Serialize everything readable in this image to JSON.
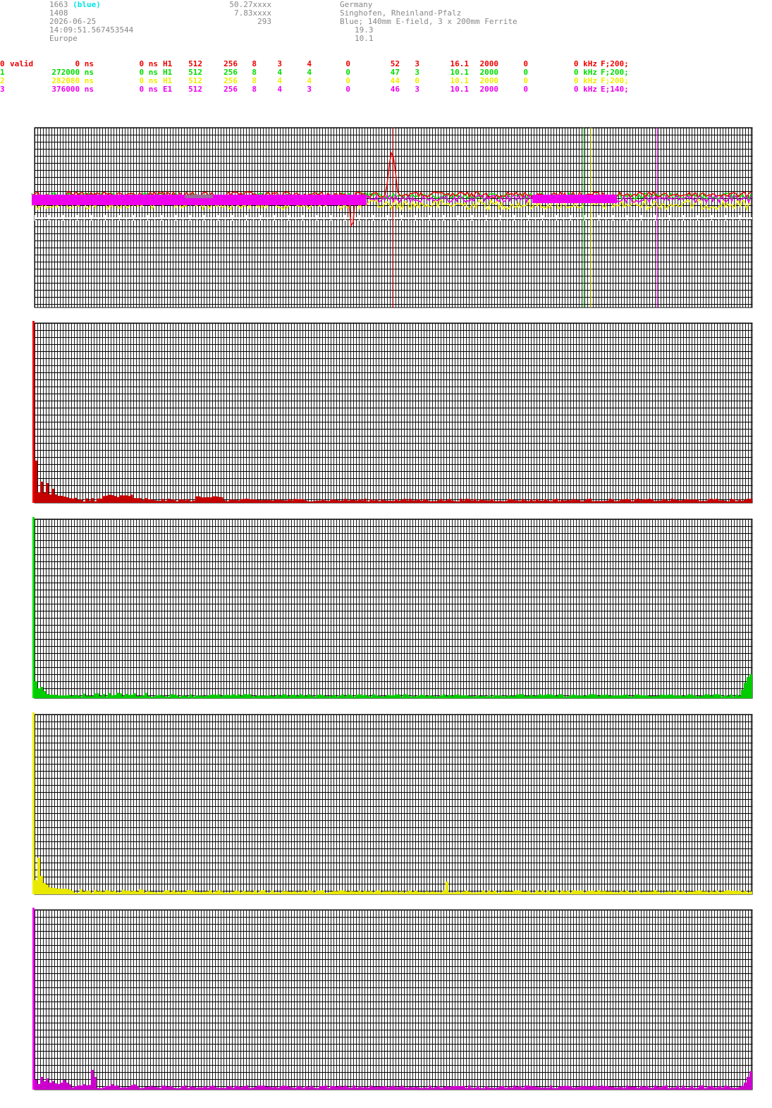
{
  "station": {
    "id": "1663",
    "id_tag": "(blue)",
    "id_tag_color": "#00e5e5",
    "number": "1408",
    "date": "2026-06-25",
    "time": "14:09:51.567453544",
    "region": "Europe",
    "lat": "50.27xxxx",
    "lon": "7.83xxxx",
    "alt": "293",
    "country": "Germany",
    "place": "Singhofen, Rheinland-Pfalz",
    "antenna": "Blue; 140mm E-field, 3 x 200mm Ferrite",
    "val1": "19.3",
    "val2": "10.1"
  },
  "channels": [
    {
      "idx": "0",
      "label": "valid",
      "offset": "0 ns",
      "delay": "0 ns",
      "type": "H1",
      "c1": "512",
      "c2": "256",
      "c3": "8",
      "c4": "3",
      "c5": "4",
      "c6": "0",
      "c7": "52",
      "c8": "3",
      "c9": "16.1",
      "c10": "2000",
      "c11": "0",
      "khz": "0 kHz",
      "cfg": "F;200;",
      "color": "#ee0000",
      "bar": "#c40000"
    },
    {
      "idx": "1",
      "label": "",
      "offset": "272000 ns",
      "delay": "0 ns",
      "type": "H1",
      "c1": "512",
      "c2": "256",
      "c3": "8",
      "c4": "4",
      "c5": "4",
      "c6": "0",
      "c7": "47",
      "c8": "3",
      "c9": "10.1",
      "c10": "2000",
      "c11": "0",
      "khz": "0 kHz",
      "cfg": "F;200;",
      "color": "#00dd00",
      "bar": "#00cc00"
    },
    {
      "idx": "2",
      "label": "",
      "offset": "282080 ns",
      "delay": "0 ns",
      "type": "H1",
      "c1": "512",
      "c2": "256",
      "c3": "8",
      "c4": "4",
      "c5": "4",
      "c6": "0",
      "c7": "44",
      "c8": "0",
      "c9": "10.1",
      "c10": "2000",
      "c11": "0",
      "khz": "0 kHz",
      "cfg": "F;200;",
      "color": "#eeee00",
      "bar": "#e8e800"
    },
    {
      "idx": "3",
      "label": "",
      "offset": "376000 ns",
      "delay": "0 ns",
      "type": "E1",
      "c1": "512",
      "c2": "256",
      "c3": "8",
      "c4": "4",
      "c5": "3",
      "c6": "0",
      "c7": "46",
      "c8": "3",
      "c9": "10.1",
      "c10": "2000",
      "c11": "0",
      "khz": "0 kHz",
      "cfg": "E;140;",
      "color": "#ee00ee",
      "bar": "#cc00cc"
    }
  ],
  "colors": {
    "grid": "#000000",
    "baseline": "#ffffff",
    "gray": "#888888"
  }
}
